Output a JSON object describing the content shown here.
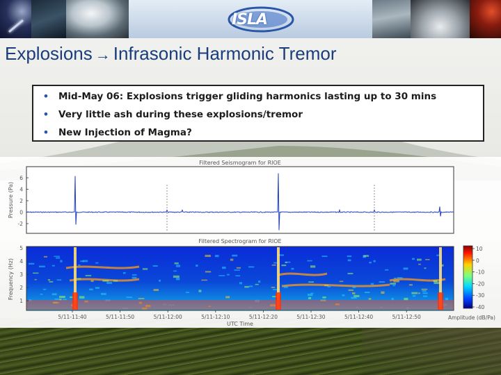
{
  "header": {
    "logo_text": "ISLA",
    "title_left": "Explosions",
    "title_arrow": "→",
    "title_right": "Infrasonic Harmonic Tremor"
  },
  "bullets": [
    {
      "marker": "•",
      "text": "Mid-May 06: Explosions trigger gliding harmonics lasting up to 30 mins"
    },
    {
      "marker": "•",
      "text": "Very little ash during these explosions/tremor"
    },
    {
      "marker": "•",
      "text": "New Injection of Magma?"
    }
  ],
  "figure": {
    "top_panel": {
      "title": "Filtered Seismogram for RIOE",
      "ylabel": "Pressure (Pa)",
      "yticks": [
        "6",
        "4",
        "2",
        "0",
        "-2"
      ]
    },
    "bottom_panel": {
      "title": "Filtered Spectrogram for RIOE",
      "ylabel": "Frequency (Hz)",
      "yticks": [
        "5",
        "4",
        "3",
        "2",
        "1"
      ]
    },
    "xticks": [
      "5/11-11:40",
      "5/11-11:50",
      "5/11-12:00",
      "5/11-12:10",
      "5/11-12:20",
      "5/11-12:30",
      "5/11-12:40",
      "5/11-12:50"
    ],
    "xlabel": "UTC Time",
    "colorbar": {
      "ticks": [
        "10",
        "0",
        "-10",
        "-20",
        "-30",
        "-40"
      ],
      "label": "Amplitude (dB/Pa)"
    }
  },
  "colors": {
    "title": "#1a3d7c",
    "bullet_marker": "#2b55a7",
    "trace": "#1f3fbf"
  }
}
